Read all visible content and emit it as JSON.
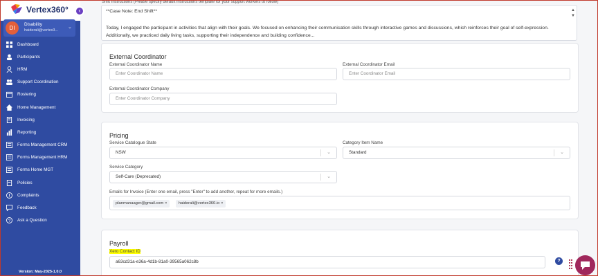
{
  "brand": {
    "name": "Vertex360°"
  },
  "user": {
    "initials": "DI",
    "role": "Disability",
    "email": "haiderali@vertex3..."
  },
  "nav": [
    {
      "label": "Dashboard",
      "icon": "dashboard-icon"
    },
    {
      "label": "Participants",
      "icon": "participants-icon"
    },
    {
      "label": "HRM",
      "icon": "hrm-icon"
    },
    {
      "label": "Support Coordination",
      "icon": "support-coordination-icon"
    },
    {
      "label": "Rostering",
      "icon": "rostering-icon"
    },
    {
      "label": "Home Management",
      "icon": "home-icon"
    },
    {
      "label": "Invoicing",
      "icon": "invoicing-icon"
    },
    {
      "label": "Reporting",
      "icon": "reporting-icon"
    },
    {
      "label": "Forms Management CRM",
      "icon": "forms-crm-icon"
    },
    {
      "label": "Forms Management HRM",
      "icon": "forms-hrm-icon"
    },
    {
      "label": "Forms Home MGT",
      "icon": "forms-home-icon"
    },
    {
      "label": "Policies",
      "icon": "policies-icon"
    },
    {
      "label": "Complaints",
      "icon": "complaints-icon"
    },
    {
      "label": "Feedback",
      "icon": "feedback-icon"
    },
    {
      "label": "Ask a Question",
      "icon": "question-icon"
    }
  ],
  "version": "Version: May-2025-1.0.0",
  "shift": {
    "label": "Shift Instructions (Please specify default instructions template for your support workers to follow)",
    "title": "**Case Note: End Shift**",
    "body": "Today, I engaged the participant in activities that align with their goals. We focused on enhancing their communication skills through interactive games and discussions, which reinforces their goal of self-expression. Additionally, we practiced daily living tasks, supporting their independence and building confidence..."
  },
  "external": {
    "title": "External Coordinator",
    "name_label": "External Coordinator Name",
    "name_placeholder": "Enter Coordinator Name",
    "email_label": "External Coordinator Email",
    "email_placeholder": "Enter Coordinator Email",
    "company_label": "External Coordinator Company",
    "company_placeholder": "Enter Coordinator Company"
  },
  "pricing": {
    "title": "Pricing",
    "state_label": "Service Catalogue State",
    "state_value": "NSW",
    "category_item_label": "Category Item Name",
    "category_item_value": "Standard",
    "category_label": "Service Category",
    "category_value": "Self-Care (Deprecated)",
    "emails_label": "Emails for Invoice (Enter one email, press \"Enter\" to add another, repeat for more emails.)",
    "emails": [
      "planmanaager@gmail.com ×",
      "haiderali@vertex360.io ×"
    ]
  },
  "payroll": {
    "title": "Payroll",
    "xero_label": "Xero Contact ID",
    "xero_value": "a63cd31a-e36a-4d1b-81a0-39565a062c8b"
  },
  "colors": {
    "sidebar": "#2f4ba1",
    "chat": "#a0285c",
    "highlight": "#ffff00"
  }
}
